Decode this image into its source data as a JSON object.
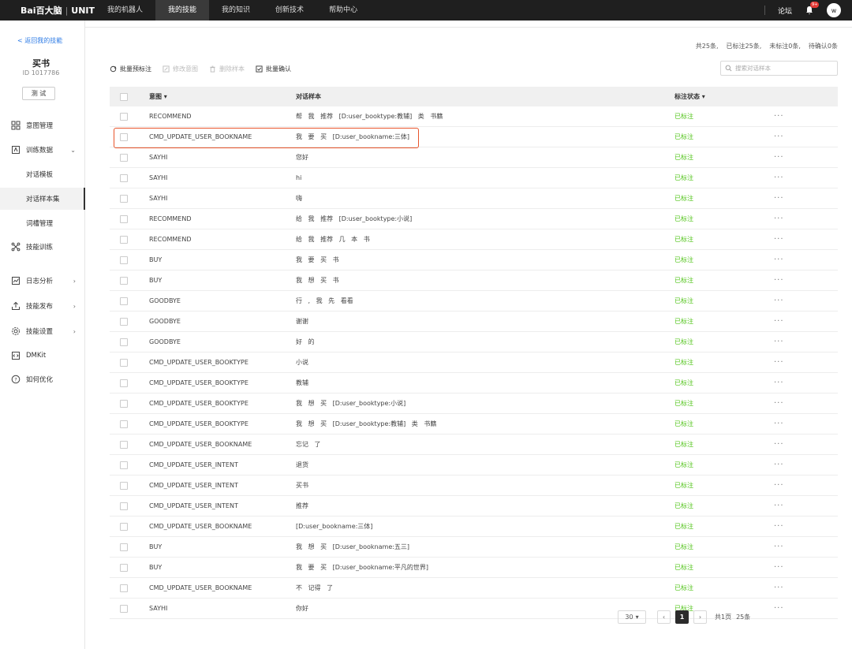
{
  "nav": {
    "logo": "Bai百大脑",
    "logo_sep": "|",
    "logo_unit": "UNIT",
    "tabs": [
      "我的机器人",
      "我的技能",
      "我的知识",
      "创新技术",
      "帮助中心"
    ],
    "active_tab": 1,
    "forum": "论坛",
    "badge": "9+",
    "avatar": "w"
  },
  "sidebar": {
    "back": "< 返回我的技能",
    "skill_name": "买书",
    "skill_id": "ID 1017786",
    "test_button": "测 试",
    "items": [
      {
        "label": "意图管理",
        "icon": "grid-icon",
        "arrow": ""
      },
      {
        "label": "训练数据",
        "icon": "data-icon",
        "arrow": "⌄"
      },
      {
        "label": "对话模板",
        "sub": true
      },
      {
        "label": "对话样本集",
        "sub": true,
        "active": true
      },
      {
        "label": "词槽管理",
        "sub": true
      },
      {
        "label": "技能训练",
        "icon": "train-icon",
        "arrow": ""
      },
      {
        "label": "日志分析",
        "icon": "chart-icon",
        "arrow": "›"
      },
      {
        "label": "技能发布",
        "icon": "publish-icon",
        "arrow": "›"
      },
      {
        "label": "技能设置",
        "icon": "gear-icon",
        "arrow": "›"
      },
      {
        "label": "DMKit",
        "icon": "code-icon",
        "arrow": ""
      },
      {
        "label": "如何优化",
        "icon": "help-icon",
        "arrow": ""
      }
    ]
  },
  "stats": {
    "total": "共25条,",
    "labeled": "已标注25条,",
    "unlabeled": "未标注0条,",
    "pending": "待确认0条"
  },
  "toolbar": {
    "batch_pre": "批量预标注",
    "edit_intent": "修改意图",
    "delete_sample": "删除样本",
    "batch_confirm": "批量确认"
  },
  "search": {
    "placeholder": "搜索对话样本"
  },
  "table": {
    "headers": {
      "intent": "意图 ▾",
      "sample": "对话样本",
      "status": "标注状态 ▾"
    },
    "rows": [
      {
        "intent": "RECOMMEND",
        "sample": "帮 我 推荐 [D:user_booktype:教辅] 类 书籍",
        "status": "已标注"
      },
      {
        "intent": "CMD_UPDATE_USER_BOOKNAME",
        "sample": "我 要 买 [D:user_bookname:三体]",
        "status": "已标注"
      },
      {
        "intent": "SAYHI",
        "sample": "您好",
        "status": "已标注"
      },
      {
        "intent": "SAYHI",
        "sample": "hi",
        "status": "已标注"
      },
      {
        "intent": "SAYHI",
        "sample": "嗨",
        "status": "已标注"
      },
      {
        "intent": "RECOMMEND",
        "sample": "给 我 推荐 [D:user_booktype:小说]",
        "status": "已标注"
      },
      {
        "intent": "RECOMMEND",
        "sample": "给 我 推荐 几 本 书",
        "status": "已标注"
      },
      {
        "intent": "BUY",
        "sample": "我 要 买 书",
        "status": "已标注"
      },
      {
        "intent": "BUY",
        "sample": "我 想 买 书",
        "status": "已标注"
      },
      {
        "intent": "GOODBYE",
        "sample": "行 , 我 先 看看",
        "status": "已标注"
      },
      {
        "intent": "GOODBYE",
        "sample": "谢谢",
        "status": "已标注"
      },
      {
        "intent": "GOODBYE",
        "sample": "好 的",
        "status": "已标注"
      },
      {
        "intent": "CMD_UPDATE_USER_BOOKTYPE",
        "sample": "小说",
        "status": "已标注"
      },
      {
        "intent": "CMD_UPDATE_USER_BOOKTYPE",
        "sample": "教辅",
        "status": "已标注"
      },
      {
        "intent": "CMD_UPDATE_USER_BOOKTYPE",
        "sample": "我 想 买 [D:user_booktype:小说]",
        "status": "已标注"
      },
      {
        "intent": "CMD_UPDATE_USER_BOOKTYPE",
        "sample": "我 想 买 [D:user_booktype:教辅] 类 书籍",
        "status": "已标注"
      },
      {
        "intent": "CMD_UPDATE_USER_BOOKNAME",
        "sample": "忘记 了",
        "status": "已标注"
      },
      {
        "intent": "CMD_UPDATE_USER_INTENT",
        "sample": "退货",
        "status": "已标注"
      },
      {
        "intent": "CMD_UPDATE_USER_INTENT",
        "sample": "买书",
        "status": "已标注"
      },
      {
        "intent": "CMD_UPDATE_USER_INTENT",
        "sample": "推荐",
        "status": "已标注"
      },
      {
        "intent": "CMD_UPDATE_USER_BOOKNAME",
        "sample": "[D:user_bookname:三体]",
        "status": "已标注"
      },
      {
        "intent": "BUY",
        "sample": "我 想 买 [D:user_bookname:五三]",
        "status": "已标注"
      },
      {
        "intent": "BUY",
        "sample": "我 要 买 [D:user_bookname:平凡的世界]",
        "status": "已标注"
      },
      {
        "intent": "CMD_UPDATE_USER_BOOKNAME",
        "sample": "不 记得 了",
        "status": "已标注"
      },
      {
        "intent": "SAYHI",
        "sample": "你好",
        "status": "已标注"
      }
    ],
    "more": "···",
    "highlighted_row": 1
  },
  "pager": {
    "page_size": "30",
    "current": "1",
    "total_pages": "共1页",
    "total_items": "25条"
  },
  "colors": {
    "status_green": "#52c41a",
    "highlight": "#e8552c",
    "nav_bg": "#1f1f1f"
  }
}
